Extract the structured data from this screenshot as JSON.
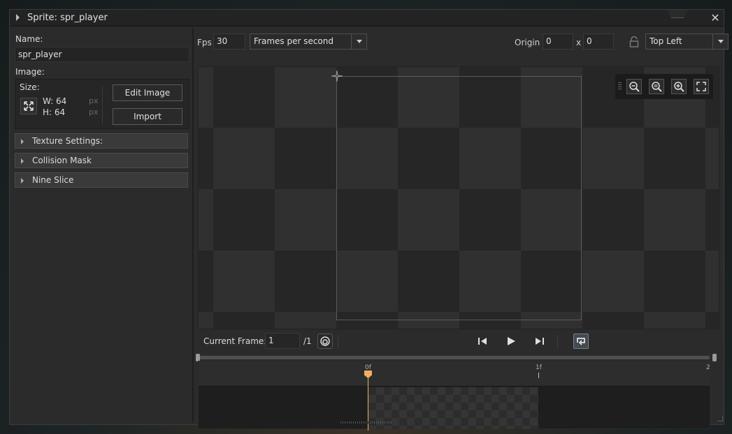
{
  "window": {
    "title": "Sprite: spr_player"
  },
  "left": {
    "name_label": "Name:",
    "name_value": "spr_player",
    "image_label": "Image:",
    "size_label": "Size:",
    "width_text": "W: 64",
    "height_text": "H: 64",
    "px_unit": "px",
    "edit_image_label": "Edit Image",
    "import_label": "Import",
    "sections": [
      {
        "label": "Texture Settings:"
      },
      {
        "label": "Collision Mask"
      },
      {
        "label": "Nine Slice"
      }
    ]
  },
  "toolbar": {
    "fps_label": "Fps",
    "fps_value": "30",
    "speed_mode": "Frames per second",
    "origin_label": "Origin",
    "origin_x": "0",
    "origin_sep": "x",
    "origin_y": "0",
    "origin_preset": "Top Left"
  },
  "playback": {
    "current_frame_label": "Current Frame:",
    "current_frame_value": "1",
    "total_frames": "/1"
  },
  "timeline": {
    "ticks": [
      "0f",
      "1f",
      "2"
    ]
  },
  "colors": {
    "accent_playhead": "#f0b060",
    "panel_bg": "#2b2b2b"
  },
  "icons": [
    "close-icon",
    "resize-icon",
    "lock-icon",
    "zoom-out-icon",
    "zoom-reset-icon",
    "zoom-in-icon",
    "fit-screen-icon",
    "onion-skin-icon",
    "skip-start-icon",
    "play-icon",
    "skip-end-icon",
    "loop-icon",
    "origin-crosshair-icon"
  ]
}
